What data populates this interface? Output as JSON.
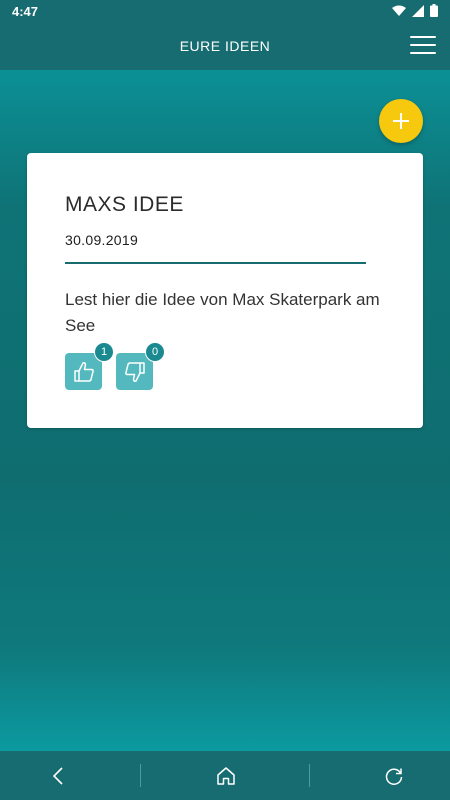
{
  "status_bar": {
    "time": "4:47",
    "icons": [
      "wifi-icon",
      "signal-icon",
      "battery-icon"
    ]
  },
  "header": {
    "title": "EURE IDEEN",
    "menu_icon": "hamburger-menu-icon"
  },
  "fab": {
    "icon": "plus-icon",
    "color": "#f6c80e"
  },
  "idea_card": {
    "title": "MAXS IDEE",
    "date": "30.09.2019",
    "text": "Lest hier die Idee von Max Skaterpark am See",
    "votes": {
      "likes": "1",
      "dislikes": "0"
    }
  },
  "nav_bar": {
    "items": [
      "back-icon",
      "home-icon",
      "refresh-icon"
    ]
  },
  "colors": {
    "primary": "#166c70",
    "accent": "#f6c80e",
    "vote_button": "#54b9be",
    "badge": "#1b8a90"
  }
}
